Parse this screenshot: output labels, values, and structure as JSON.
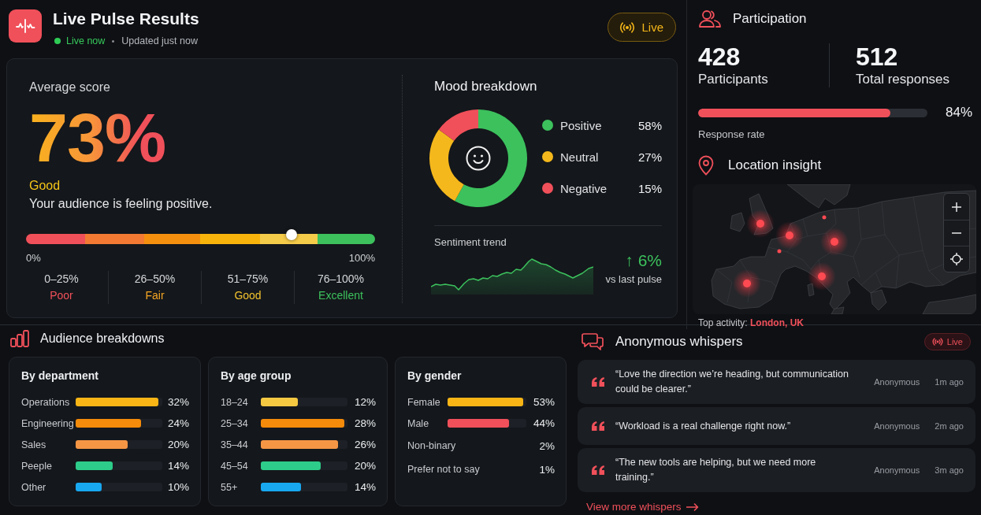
{
  "header": {
    "title": "Live Pulse Results",
    "status": "Live now",
    "updated": "Updated just now",
    "badge": "Live"
  },
  "average_score": {
    "label": "Average score",
    "value": "73%",
    "rating": "Good",
    "message": "Your audience is feeling positive.",
    "meter": {
      "level": 0.76,
      "min_label": "0%",
      "max_label": "100%"
    },
    "bands": [
      {
        "range": "0–25%",
        "label": "Poor",
        "color": "#f0505a"
      },
      {
        "range": "26–50%",
        "label": "Fair",
        "color": "#f5a623"
      },
      {
        "range": "51–75%",
        "label": "Good",
        "color": "#f2c12e"
      },
      {
        "range": "76–100%",
        "label": "Excellent",
        "color": "#3cc15d"
      }
    ]
  },
  "mood": {
    "title": "Mood breakdown",
    "chart_data": {
      "type": "donut",
      "categories": [
        "Positive",
        "Neutral",
        "Negative"
      ],
      "values": [
        58,
        27,
        15
      ]
    },
    "legend": [
      {
        "value": "58%",
        "color": "#3cc15d"
      },
      {
        "value": "27%",
        "color": "#f5b81c"
      },
      {
        "value": "15%",
        "color": "#f0505a"
      }
    ]
  },
  "sentiment_trend": {
    "title": "Sentiment trend",
    "change": "↑ 6%",
    "caption": "vs last pulse"
  },
  "participation": {
    "title": "Participation",
    "stats": [
      {
        "value": "428",
        "label": "Participants"
      },
      {
        "value": "512",
        "label": "Total responses"
      }
    ],
    "response_rate": {
      "level": 0.84,
      "value": "84%",
      "label": "Response rate"
    }
  },
  "location": {
    "title": "Location insight",
    "top_activity_label": "Top activity:",
    "top_activity": "London, UK"
  },
  "breakdowns": {
    "title": "Audience breakdowns",
    "groups": [
      {
        "title": "By department",
        "rows": [
          {
            "kind": "bar",
            "label": "Operations",
            "value": "32%",
            "level": 0.95,
            "color": "#f8b515"
          },
          {
            "kind": "bar",
            "label": "Engineering",
            "value": "24%",
            "level": 0.75,
            "color": "#f58b0a"
          },
          {
            "kind": "bar",
            "label": "Sales",
            "value": "20%",
            "level": 0.6,
            "color": "#f59645"
          },
          {
            "kind": "bar",
            "label": "Peeple",
            "value": "14%",
            "level": 0.43,
            "color": "#2dcc8a"
          },
          {
            "kind": "bar",
            "label": "Other",
            "value": "10%",
            "level": 0.3,
            "color": "#18a8f0"
          }
        ]
      },
      {
        "title": "By age group",
        "rows": [
          {
            "kind": "bar",
            "label": "18–24",
            "value": "12%",
            "level": 0.43,
            "color": "#f5c842"
          },
          {
            "kind": "bar",
            "label": "25–34",
            "value": "28%",
            "level": 0.96,
            "color": "#f58b0a"
          },
          {
            "kind": "bar",
            "label": "35–44",
            "value": "26%",
            "level": 0.89,
            "color": "#f59645"
          },
          {
            "kind": "bar",
            "label": "45–54",
            "value": "20%",
            "level": 0.69,
            "color": "#2dcc8a"
          },
          {
            "kind": "bar",
            "label": "55+",
            "value": "14%",
            "level": 0.46,
            "color": "#18a8f0"
          }
        ]
      },
      {
        "title": "By gender",
        "rows": [
          {
            "kind": "bar",
            "label": "Female",
            "value": "53%",
            "level": 0.96,
            "color": "#f8b515"
          },
          {
            "kind": "bar",
            "label": "Male",
            "value": "44%",
            "level": 0.78,
            "color": "#f0505a"
          },
          {
            "kind": "plain",
            "label": "Non-binary",
            "value": "2%"
          },
          {
            "kind": "plain",
            "label": "Prefer not to say",
            "value": "1%"
          }
        ]
      }
    ]
  },
  "whispers": {
    "title": "Anonymous whispers",
    "badge": "Live",
    "items": [
      {
        "text": "“Love the direction we’re heading, but communication could be clearer.”",
        "author": "Anonymous",
        "time": "1m ago"
      },
      {
        "text": "“Workload is a real challenge right now.”",
        "author": "Anonymous",
        "time": "2m ago"
      },
      {
        "text": "“The new tools are helping, but we need more training.”",
        "author": "Anonymous",
        "time": "3m ago"
      }
    ],
    "link": "View more whispers"
  }
}
